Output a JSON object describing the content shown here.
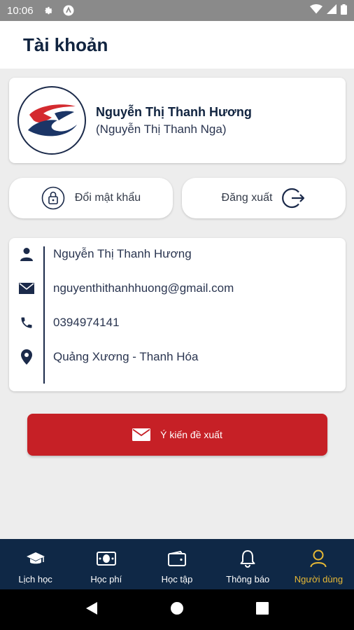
{
  "status_bar": {
    "time": "10:06"
  },
  "header": {
    "title": "Tài khoản"
  },
  "profile": {
    "name": "Nguyễn Thị Thanh Hương",
    "alias": "(Nguyễn Thị Thanh Nga)"
  },
  "actions": {
    "change_password": "Đổi mật khẩu",
    "logout": "Đăng xuất"
  },
  "info": {
    "full_name": "Nguyễn Thị Thanh Hương",
    "email": "nguyenthithanhhuong@gmail.com",
    "phone": "0394974141",
    "address": "Quảng Xương - Thanh Hóa"
  },
  "suggest_button": {
    "label": "Ý kiến đề xuất"
  },
  "bottom_nav": {
    "items": [
      {
        "label": "Lịch học",
        "icon": "graduation-cap-icon"
      },
      {
        "label": "Học phí",
        "icon": "money-icon"
      },
      {
        "label": "Học tập",
        "icon": "wallet-icon"
      },
      {
        "label": "Thông báo",
        "icon": "bell-icon"
      },
      {
        "label": "Người dùng",
        "icon": "user-icon"
      }
    ],
    "active_index": 4
  },
  "colors": {
    "brand_navy": "#0f2846",
    "accent_red": "#c62026",
    "active_gold": "#e8b935"
  }
}
